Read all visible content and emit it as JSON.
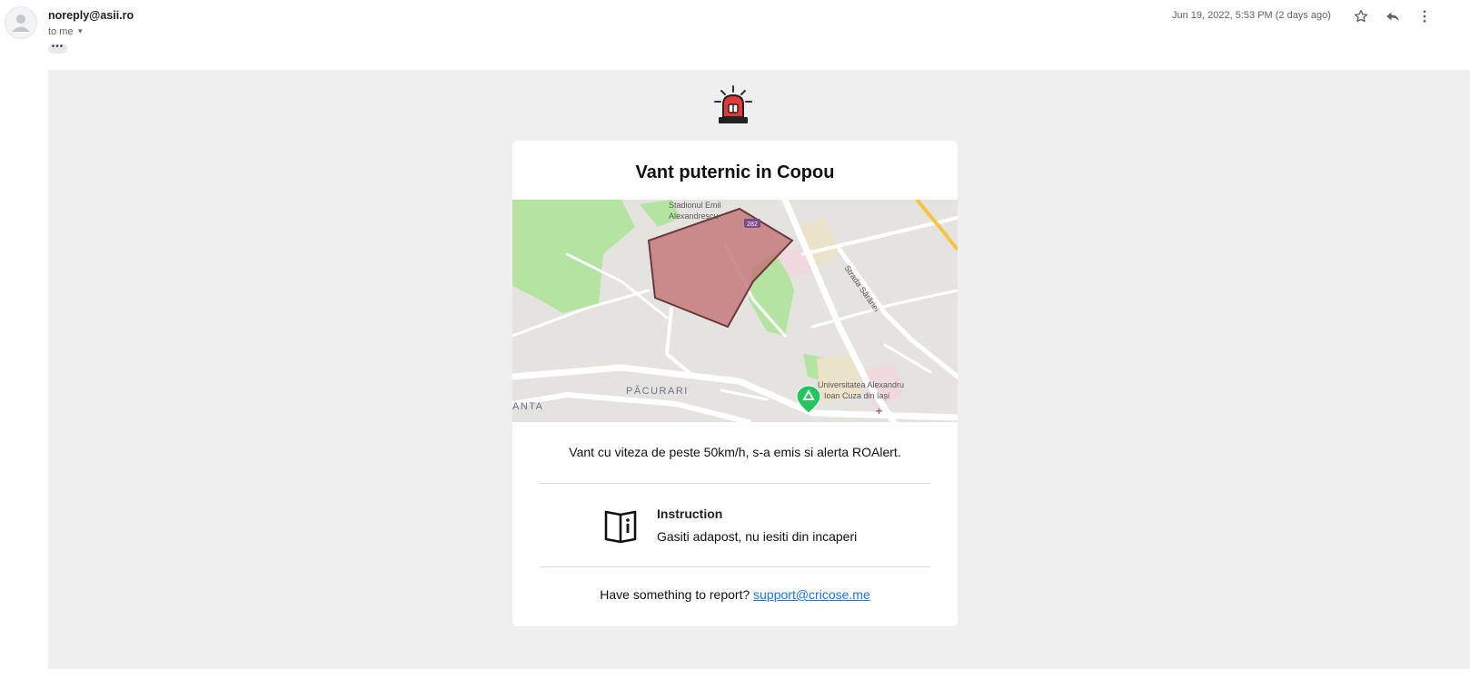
{
  "header": {
    "sender": "noreply@asii.ro",
    "recipient": "to me",
    "date": "Jun 19, 2022, 5:53 PM (2 days ago)",
    "ellipsis": "•••"
  },
  "alert": {
    "title": "Vant puternic in Copou",
    "description": "Vant cu viteza de peste 50km/h, s-a emis si alerta ROAlert.",
    "instruction_label": "Instruction",
    "instruction_text": "Gasiti adapost, nu iesiti din incaperi",
    "report_prompt": "Have something to report?",
    "report_email": "support@cricose.me"
  },
  "map": {
    "labels": {
      "stadium_line1": "Stadionul Emil",
      "stadium_line2": "Alexandrescu",
      "street": "Strada Sărăriei",
      "district": "PĂCURARI",
      "district_left": "ANTA",
      "university_line1": "Universitatea Alexandru",
      "university_line2": "Ioan Cuza din Iași",
      "road_badge": "282"
    },
    "colors": {
      "land": "#e5e3df",
      "park": "#b5e3a2",
      "road": "#ffffff",
      "area_fill": "#c06b6e",
      "area_stroke": "#6b3a3c",
      "marker": "#22c55e"
    }
  },
  "colors": {
    "email_background": "#efefef",
    "link": "#1a73e8",
    "siren_red": "#e53935"
  },
  "icons": [
    "star-icon",
    "reply-icon",
    "more-vert-icon",
    "siren-icon",
    "instruction-book-icon",
    "person-icon"
  ]
}
